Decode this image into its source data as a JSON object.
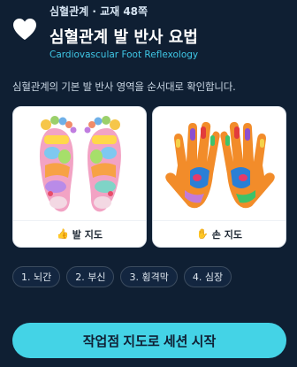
{
  "header": {
    "eyebrow": "심혈관계 · 교재 48쪽",
    "title": "심혈관계 발 반사 요법",
    "subtitle": "Cardiovascular Foot Reflexology",
    "icon": "heart-icon"
  },
  "description": "심혈관계의 기본 발 반사 영역을 순서대로 확인합니다.",
  "cards": [
    {
      "icon": "👍",
      "label": "발 지도"
    },
    {
      "icon": "✋",
      "label": "손 지도"
    }
  ],
  "steps": [
    "1. 뇌간",
    "2. 부신",
    "3. 횡격막",
    "4. 심장"
  ],
  "cta": {
    "label": "작업점 지도로 세션 시작"
  },
  "colors": {
    "background": "#0f1f33",
    "accent": "#44d3e6",
    "subtitle": "#3fc7e6"
  }
}
